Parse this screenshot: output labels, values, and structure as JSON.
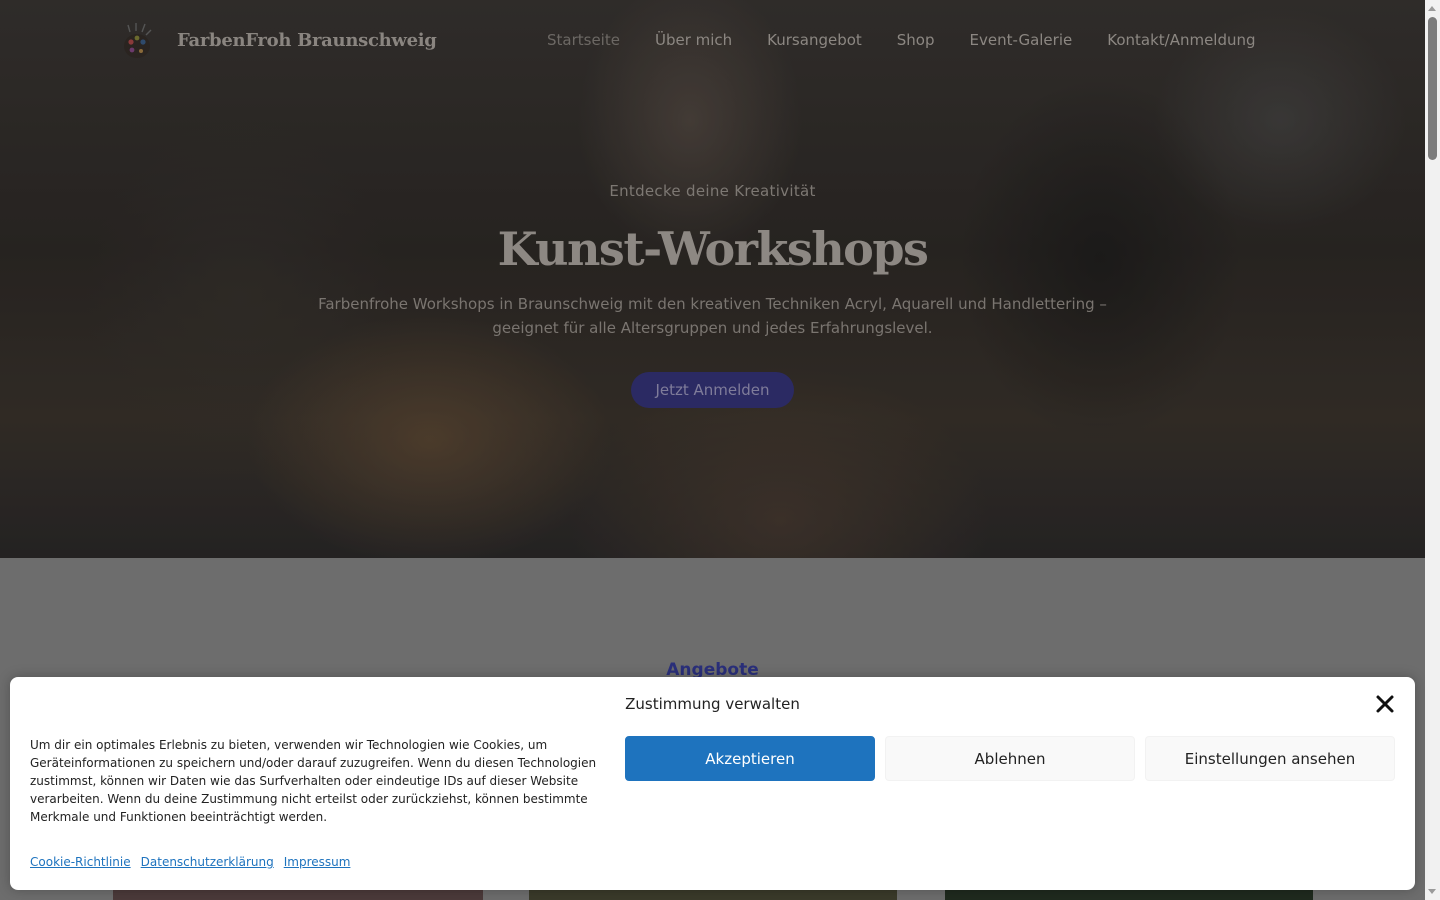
{
  "header": {
    "brand": "FarbenFroh Braunschweig",
    "logo_icon": "painter-palette-icon",
    "nav": [
      {
        "label": "Startseite",
        "active": true
      },
      {
        "label": "Über mich",
        "active": false
      },
      {
        "label": "Kursangebot",
        "active": false
      },
      {
        "label": "Shop",
        "active": false
      },
      {
        "label": "Event-Galerie",
        "active": false
      },
      {
        "label": "Kontakt/Anmeldung",
        "active": false
      }
    ]
  },
  "hero": {
    "kicker": "Entdecke deine Kreativität",
    "title": "Kunst-Workshops",
    "description": "Farbenfrohe Workshops in Braunschweig mit den kreativen Techniken Acryl, Aquarell und Handlettering – geeignet für alle Altersgruppen und jedes Erfahrungslevel.",
    "cta": "Jetzt Anmelden"
  },
  "offers": {
    "label": "Angebote"
  },
  "consent": {
    "title": "Zustimmung verwalten",
    "text": "Um dir ein optimales Erlebnis zu bieten, verwenden wir Technologien wie Cookies, um Geräteinformationen zu speichern und/oder darauf zuzugreifen. Wenn du diesen Technologien zustimmst, können wir Daten wie das Surfverhalten oder eindeutige IDs auf dieser Website verarbeiten. Wenn du deine Zustimmung nicht erteilst oder zurückziehst, können bestimmte Merkmale und Funktionen beeinträchtigt werden.",
    "accept": "Akzeptieren",
    "deny": "Ablehnen",
    "settings": "Einstellungen ansehen",
    "links": [
      "Cookie-Richtlinie",
      "Datenschutzerklärung",
      "Impressum"
    ],
    "close_icon": "close-icon"
  },
  "colors": {
    "accent": "#1e73be",
    "hero_button": "#2b2a63",
    "section_label": "#2a2f7a"
  }
}
